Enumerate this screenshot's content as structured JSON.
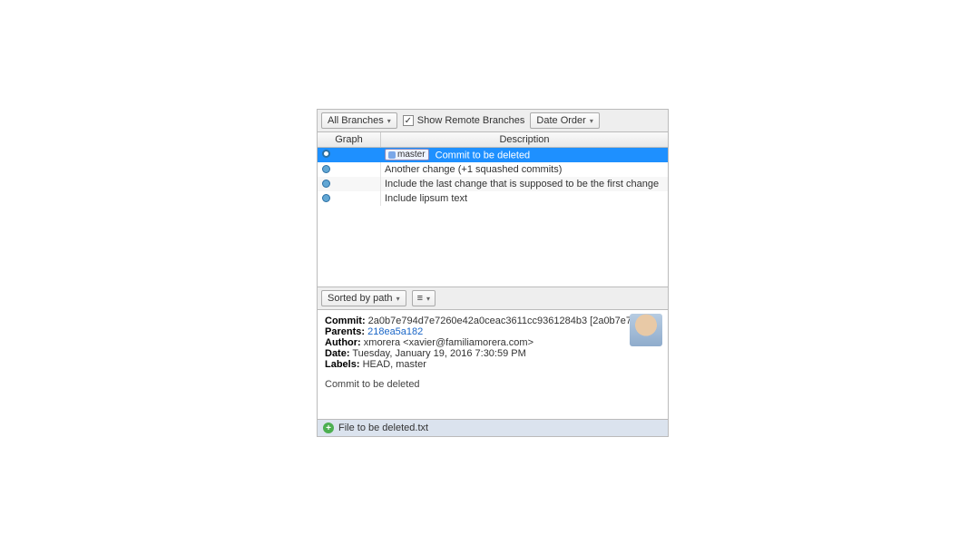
{
  "toolbar": {
    "branches_filter": "All Branches",
    "show_remote_label": "Show Remote Branches",
    "show_remote_checked": true,
    "order": "Date Order"
  },
  "columns": {
    "graph": "Graph",
    "description": "Description"
  },
  "commits": [
    {
      "description": "Commit to be deleted",
      "branch_tag": "master",
      "selected": true,
      "head": true
    },
    {
      "description": "Another change (+1 squashed commits)"
    },
    {
      "description": "Include the last change that is supposed to be the first change"
    },
    {
      "description": "Include lipsum text"
    }
  ],
  "lowbar": {
    "sort": "Sorted by path"
  },
  "details": {
    "commit_label": "Commit:",
    "commit_hash": "2a0b7e794d7e7260e42a0ceac3611cc9361284b3 [2a0b7e7]",
    "parents_label": "Parents:",
    "parents_link": "218ea5a182",
    "author_label": "Author:",
    "author_value": "xmorera <xavier@familiamorera.com>",
    "date_label": "Date:",
    "date_value": "Tuesday, January 19, 2016 7:30:59 PM",
    "labels_label": "Labels:",
    "labels_value": "HEAD, master",
    "message": "Commit to be deleted"
  },
  "files": [
    {
      "name": "File to be deleted.txt"
    }
  ]
}
